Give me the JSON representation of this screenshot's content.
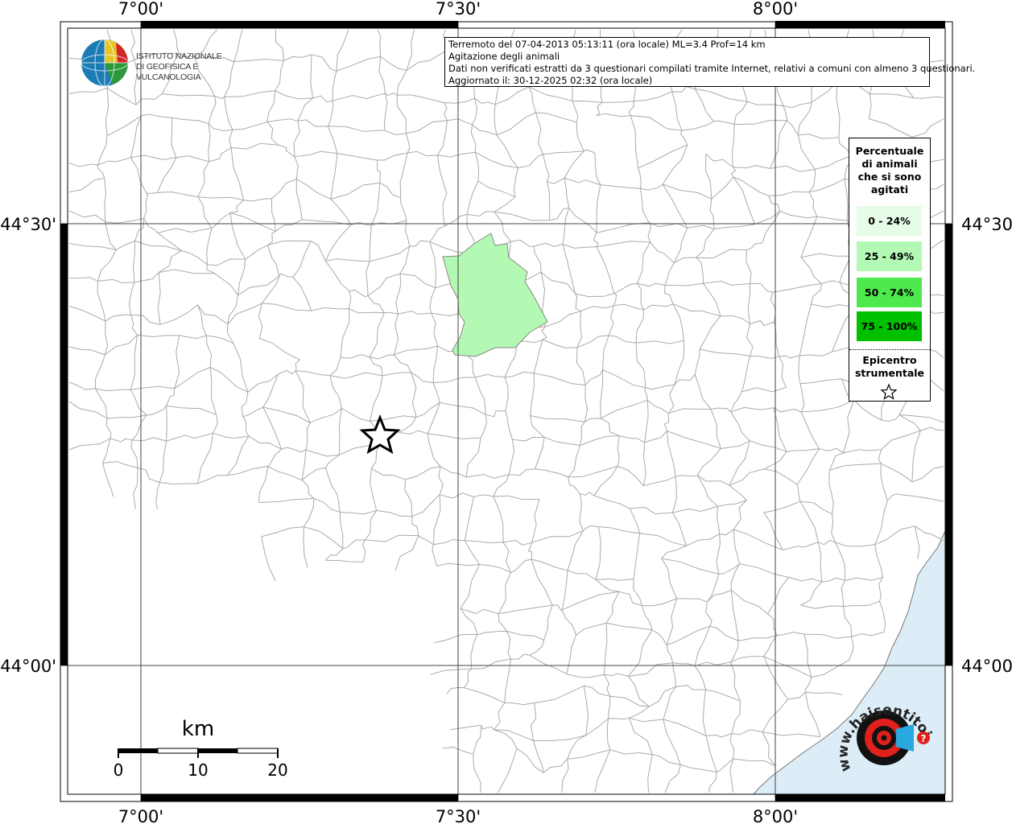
{
  "info": {
    "line1": "Terremoto del 07-04-2013 05:13:11 (ora locale) ML=3.4 Prof=14 km",
    "line2": "Agitazione degli animali",
    "line3": "Dati non verificati estratti da 3 questionari compilati tramite Internet, relativi a comuni con almeno 3 questionari.",
    "line4": "Aggiornato il: 30-12-2025 02:32 (ora locale)"
  },
  "axes": {
    "top": [
      "7°00'",
      "7°30'",
      "8°00'"
    ],
    "bottom": [
      "7°00'",
      "7°30'",
      "8°00'"
    ],
    "left": [
      "44°30'",
      "44°00'"
    ],
    "right": [
      "44°30'",
      "44°00'"
    ]
  },
  "logo": {
    "line1": "ISTITUTO NAZIONALE",
    "line2": "DI GEOFISICA E VULCANOLOGIA"
  },
  "legend": {
    "title_lines": [
      "Percentuale",
      "di animali",
      "che si sono",
      "agitati"
    ],
    "classes": [
      {
        "label": "0 - 24%",
        "color": "#e6fce6"
      },
      {
        "label": "25 - 49%",
        "color": "#b3f9b3"
      },
      {
        "label": "50 - 74%",
        "color": "#4de94d"
      },
      {
        "label": "75 - 100%",
        "color": "#00c000"
      }
    ],
    "epicenter_lines": [
      "Epicentro",
      "strumentale"
    ]
  },
  "scale": {
    "unit": "km",
    "ticks": [
      "0",
      "10",
      "20"
    ]
  },
  "watermark": {
    "text": "www.haisentitoilterremoto.it",
    "accent": "#e0201c"
  },
  "colors": {
    "sea": "#dcedf8",
    "border": "#aaaaaa",
    "highlighted_commune": "#b3f9b3"
  }
}
